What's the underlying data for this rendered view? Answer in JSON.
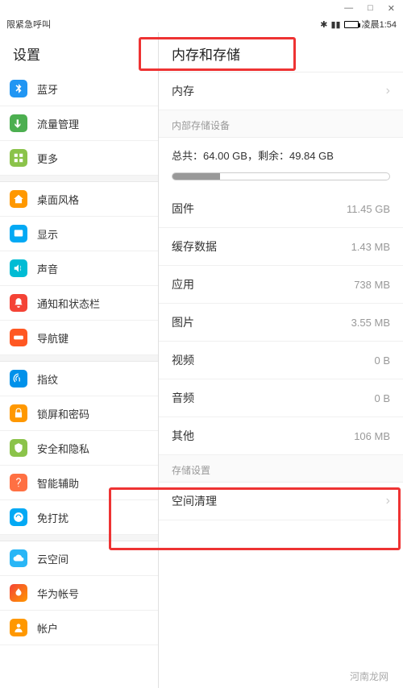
{
  "window": {
    "minimize": "—",
    "maximize": "□",
    "close": "✕"
  },
  "status_bar": {
    "left_text": "限紧急呼叫",
    "bluetooth": "⁎",
    "signal": "📶",
    "time": "凌晨1:54"
  },
  "left_panel": {
    "title": "设置",
    "groups": [
      [
        {
          "icon": "bluetooth-icon",
          "cls": "ic-blue",
          "label": "蓝牙"
        },
        {
          "icon": "data-icon",
          "cls": "ic-green",
          "label": "流量管理"
        },
        {
          "icon": "more-icon",
          "cls": "ic-lgreen",
          "label": "更多"
        }
      ],
      [
        {
          "icon": "home-style-icon",
          "cls": "ic-orange",
          "label": "桌面风格"
        },
        {
          "icon": "display-icon",
          "cls": "ic-cyan",
          "label": "显示"
        },
        {
          "icon": "sound-icon",
          "cls": "ic-teal",
          "label": "声音"
        },
        {
          "icon": "notification-icon",
          "cls": "ic-red",
          "label": "通知和状态栏"
        },
        {
          "icon": "navkey-icon",
          "cls": "ic-dorange",
          "label": "导航键"
        }
      ],
      [
        {
          "icon": "fingerprint-icon",
          "cls": "ic-fprint",
          "label": "指纹"
        },
        {
          "icon": "lock-icon",
          "cls": "ic-orange",
          "label": "锁屏和密码"
        },
        {
          "icon": "security-icon",
          "cls": "ic-lgreen",
          "label": "安全和隐私"
        },
        {
          "icon": "assist-icon",
          "cls": "ic-grid",
          "label": "智能辅助"
        },
        {
          "icon": "dnd-icon",
          "cls": "ic-cyan",
          "label": "免打扰"
        }
      ],
      [
        {
          "icon": "cloud-icon",
          "cls": "ic-cloud",
          "label": "云空间"
        },
        {
          "icon": "huawei-icon",
          "cls": "ic-huawei",
          "label": "华为帐号"
        },
        {
          "icon": "account-icon",
          "cls": "ic-user",
          "label": "帐户"
        }
      ]
    ]
  },
  "right_panel": {
    "title": "内存和存储",
    "memory_row": {
      "label": "内存"
    },
    "internal_header": "内部存储设备",
    "storage": {
      "total_label": "总共：",
      "total_value": "64.00 GB",
      "sep": "，",
      "free_label": "剩余：",
      "free_value": "49.84 GB",
      "used_pct": 22
    },
    "items": [
      {
        "label": "固件",
        "value": "11.45 GB"
      },
      {
        "label": "缓存数据",
        "value": "1.43 MB"
      },
      {
        "label": "应用",
        "value": "738 MB"
      },
      {
        "label": "图片",
        "value": "3.55 MB"
      },
      {
        "label": "视频",
        "value": "0 B"
      },
      {
        "label": "音频",
        "value": "0 B"
      },
      {
        "label": "其他",
        "value": "106 MB"
      }
    ],
    "storage_settings_header": "存储设置",
    "cleanup_label": "空间清理"
  },
  "watermark": "河南龙网"
}
